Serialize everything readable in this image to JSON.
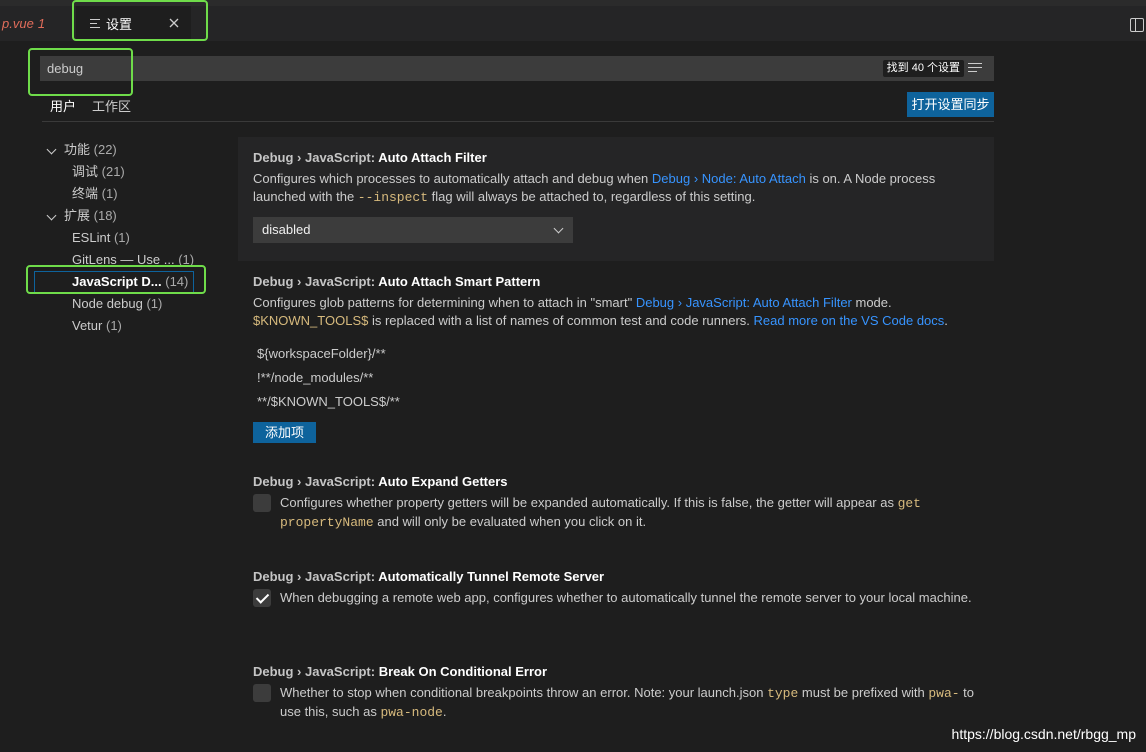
{
  "tabs": {
    "prev_label": "p.vue",
    "prev_count": "1",
    "active_label": "设置"
  },
  "search": {
    "value": "debug",
    "result_count": "找到 40 个设置"
  },
  "scope": {
    "tabs": [
      "用户",
      "工作区"
    ],
    "sync_button": "打开设置同步"
  },
  "toc": {
    "items": [
      {
        "label": "功能",
        "count": "(22)"
      },
      {
        "label": "调试",
        "count": "(21)"
      },
      {
        "label": "终端",
        "count": "(1)"
      },
      {
        "label": "扩展",
        "count": "(18)"
      },
      {
        "label": "ESLint",
        "count": "(1)"
      },
      {
        "label": "GitLens — Use ...",
        "count": "(1)"
      },
      {
        "label": "JavaScript D...",
        "count": "(14)"
      },
      {
        "label": "Node debug",
        "count": "(1)"
      },
      {
        "label": "Vetur",
        "count": "(1)"
      }
    ]
  },
  "settings": [
    {
      "category": "Debug › JavaScript: ",
      "name": "Auto Attach Filter",
      "desc_1": "Configures which processes to automatically attach and debug when ",
      "desc_link": "Debug › Node: Auto Attach",
      "desc_2": " is on. A Node process launched with the ",
      "desc_code": "--inspect",
      "desc_3": " flag will always be attached to, regardless of this setting.",
      "select_value": "disabled"
    },
    {
      "category": "Debug › JavaScript: ",
      "name": "Auto Attach Smart Pattern",
      "desc_1": "Configures glob patterns for determining when to attach in \"smart\" ",
      "desc_link": "Debug › JavaScript: Auto Attach Filter",
      "desc_2": " mode. ",
      "desc_code": "$KNOWN_TOOLS$",
      "desc_3": " is replaced with a list of names of common test and code runners. ",
      "desc_link2": "Read more on the VS Code docs",
      "desc_4": ".",
      "patterns": [
        "${workspaceFolder}/**",
        "!**/node_modules/**",
        "**/$KNOWN_TOOLS$/**"
      ],
      "add_button": "添加项"
    },
    {
      "category": "Debug › JavaScript: ",
      "name": "Auto Expand Getters",
      "desc_1": "Configures whether property getters will be expanded automatically. If this is false, the getter will appear as ",
      "desc_code": "get propertyName",
      "desc_2": " and will only be evaluated when you click on it.",
      "checked": false
    },
    {
      "category": "Debug › JavaScript: ",
      "name": "Automatically Tunnel Remote Server",
      "desc_1": "When debugging a remote web app, configures whether to automatically tunnel the remote server to your local machine.",
      "checked": true
    },
    {
      "category": "Debug › JavaScript: ",
      "name": "Break On Conditional Error",
      "desc_1": "Whether to stop when conditional breakpoints throw an error. Note: your launch.json ",
      "desc_code": "type",
      "desc_2": " must be prefixed with ",
      "desc_code2": "pwa-",
      "desc_3": " to use this, such as ",
      "desc_code3": "pwa-node",
      "desc_4": ".",
      "checked": false
    }
  ],
  "watermark": "https://blog.csdn.net/rbgg_mp"
}
